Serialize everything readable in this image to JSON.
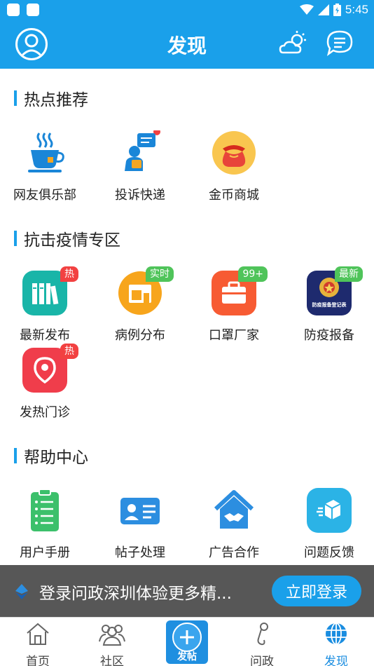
{
  "status_bar": {
    "time": "5:45"
  },
  "header": {
    "title": "发现"
  },
  "sections": {
    "hot": {
      "title": "热点推荐",
      "items": [
        {
          "label": "网友俱乐部",
          "icon": "coffee-cup-icon"
        },
        {
          "label": "投诉快递",
          "icon": "courier-complaint-icon"
        },
        {
          "label": "金币商城",
          "icon": "coin-bag-icon"
        }
      ]
    },
    "epidemic": {
      "title": "抗击疫情专区",
      "items": [
        {
          "label": "最新发布",
          "badge": "热",
          "icon": "books-icon"
        },
        {
          "label": "病例分布",
          "badge": "实时",
          "icon": "shop-icon"
        },
        {
          "label": "口罩厂家",
          "badge": "99+",
          "icon": "briefcase-icon"
        },
        {
          "label": "防疫报备",
          "badge": "最新",
          "icon": "police-emblem-icon",
          "emblem_text": "防疫报备登记表"
        },
        {
          "label": "发热门诊",
          "badge": "热",
          "icon": "location-pin-icon"
        }
      ]
    },
    "help": {
      "title": "帮助中心",
      "items": [
        {
          "label": "用户手册",
          "icon": "clipboard-icon"
        },
        {
          "label": "帖子处理",
          "icon": "id-card-icon"
        },
        {
          "label": "广告合作",
          "icon": "handshake-house-icon"
        },
        {
          "label": "问题反馈",
          "icon": "feedback-box-icon"
        }
      ]
    }
  },
  "login_banner": {
    "text": "登录问政深圳体验更多精...",
    "button": "立即登录"
  },
  "tabbar": {
    "home": "首页",
    "community": "社区",
    "post": "发帖",
    "wenzheng": "问政",
    "discover": "发现"
  },
  "colors": {
    "primary": "#1aa0ea",
    "badge_red": "#f24141",
    "badge_green": "#4fc45a"
  }
}
